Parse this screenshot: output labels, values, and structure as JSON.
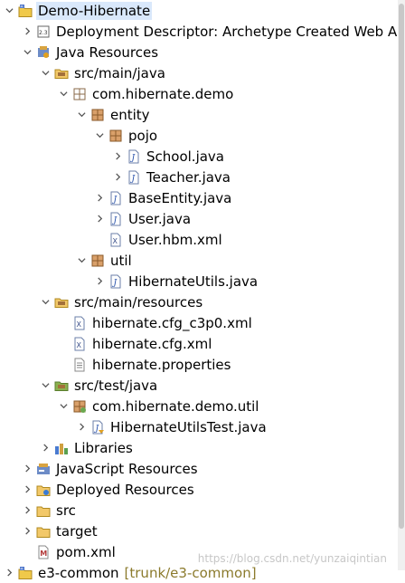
{
  "tree": [
    {
      "label": "Demo-Hibernate",
      "icon": "project-icon",
      "indent": 0,
      "arrow": "down",
      "selected": true,
      "name": "project-demo-hibernate"
    },
    {
      "label": "Deployment Descriptor: Archetype Created Web Ap",
      "icon": "deployment-descriptor-icon",
      "indent": 1,
      "arrow": "right",
      "name": "deployment-descriptor"
    },
    {
      "label": "Java Resources",
      "icon": "java-resources-icon",
      "indent": 1,
      "arrow": "down",
      "name": "java-resources"
    },
    {
      "label": "src/main/java",
      "icon": "source-folder-icon",
      "indent": 2,
      "arrow": "down",
      "name": "src-main-java"
    },
    {
      "label": "com.hibernate.demo",
      "icon": "package-empty-icon",
      "indent": 3,
      "arrow": "down",
      "name": "package-com-hibernate-demo"
    },
    {
      "label": "entity",
      "icon": "package-icon",
      "indent": 4,
      "arrow": "down",
      "name": "package-entity"
    },
    {
      "label": "pojo",
      "icon": "package-icon",
      "indent": 5,
      "arrow": "down",
      "name": "package-pojo"
    },
    {
      "label": "School.java",
      "icon": "java-file-icon",
      "indent": 6,
      "arrow": "right",
      "name": "file-school-java"
    },
    {
      "label": "Teacher.java",
      "icon": "java-file-icon",
      "indent": 6,
      "arrow": "right",
      "name": "file-teacher-java"
    },
    {
      "label": "BaseEntity.java",
      "icon": "java-file-icon",
      "indent": 5,
      "arrow": "right",
      "name": "file-baseentity-java"
    },
    {
      "label": "User.java",
      "icon": "java-file-icon",
      "indent": 5,
      "arrow": "right",
      "name": "file-user-java"
    },
    {
      "label": "User.hbm.xml",
      "icon": "xml-file-icon",
      "indent": 5,
      "arrow": "none",
      "name": "file-user-hbm-xml"
    },
    {
      "label": "util",
      "icon": "package-icon",
      "indent": 4,
      "arrow": "down",
      "name": "package-util"
    },
    {
      "label": "HibernateUtils.java",
      "icon": "java-file-icon",
      "indent": 5,
      "arrow": "right",
      "name": "file-hibernateutils-java"
    },
    {
      "label": "src/main/resources",
      "icon": "source-folder-icon",
      "indent": 2,
      "arrow": "down",
      "name": "src-main-resources"
    },
    {
      "label": "hibernate.cfg_c3p0.xml",
      "icon": "xml-file-icon",
      "indent": 3,
      "arrow": "none",
      "name": "file-hibernate-cfg-c3p0-xml"
    },
    {
      "label": "hibernate.cfg.xml",
      "icon": "xml-file-icon",
      "indent": 3,
      "arrow": "none",
      "name": "file-hibernate-cfg-xml"
    },
    {
      "label": "hibernate.properties",
      "icon": "properties-file-icon",
      "indent": 3,
      "arrow": "none",
      "name": "file-hibernate-properties"
    },
    {
      "label": "src/test/java",
      "icon": "test-source-folder-icon",
      "indent": 2,
      "arrow": "down",
      "name": "src-test-java"
    },
    {
      "label": "com.hibernate.demo.util",
      "icon": "test-package-icon",
      "indent": 3,
      "arrow": "down",
      "name": "package-com-hibernate-demo-util"
    },
    {
      "label": "HibernateUtilsTest.java",
      "icon": "test-java-file-icon",
      "indent": 4,
      "arrow": "right",
      "name": "file-hibernateutilstest-java"
    },
    {
      "label": "Libraries",
      "icon": "libraries-icon",
      "indent": 2,
      "arrow": "right",
      "name": "libraries"
    },
    {
      "label": "JavaScript Resources",
      "icon": "javascript-resources-icon",
      "indent": 1,
      "arrow": "right",
      "name": "javascript-resources"
    },
    {
      "label": "Deployed Resources",
      "icon": "deployed-resources-icon",
      "indent": 1,
      "arrow": "right",
      "name": "deployed-resources"
    },
    {
      "label": "src",
      "icon": "folder-icon",
      "indent": 1,
      "arrow": "right",
      "name": "folder-src"
    },
    {
      "label": "target",
      "icon": "folder-icon",
      "indent": 1,
      "arrow": "right",
      "name": "folder-target"
    },
    {
      "label": "pom.xml",
      "icon": "maven-pom-icon",
      "indent": 1,
      "arrow": "none",
      "name": "file-pom-xml"
    },
    {
      "label": "e3-common",
      "icon": "project-icon",
      "indent": 0,
      "arrow": "right",
      "decoration": "[trunk/e3-common]",
      "name": "project-e3-common"
    }
  ],
  "watermark": "https://blog.csdn.net/yunzaiqintian",
  "colors": {
    "selection": "#d9e8fb",
    "decoration": "#8b7a2c",
    "package": "#b5651d",
    "java": "#1f4aa8",
    "folder": "#e0b040"
  }
}
